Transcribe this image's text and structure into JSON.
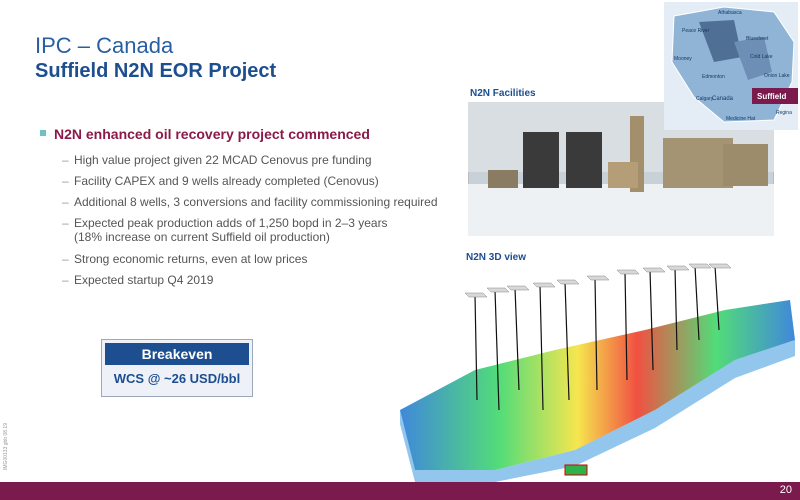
{
  "slide": {
    "title_line1": "IPC – Canada",
    "title_line2": "Suffield N2N EOR Project",
    "main_bullet": "N2N enhanced oil recovery project commenced",
    "sub_items": [
      "High value project given 22 MCAD Cenovus pre funding",
      "Facility CAPEX and 9 wells already completed (Cenovus)",
      "Additional 8 wells, 3 conversions and facility commissioning required",
      "Expected peak production adds of 1,250 bopd in 2–3 years",
      "(18% increase on current Suffield oil production)",
      "Strong economic returns, even at low prices",
      "Expected startup Q4 2019"
    ],
    "breakeven_title": "Breakeven",
    "breakeven_value": "WCS @ ~26 USD/bbl",
    "facilities_label": "N2N Facilities",
    "view_label": "N2N 3D view",
    "page_number": "20",
    "side_code": "IMG00133 gbb 08.19"
  },
  "map": {
    "labels": [
      "Athabasca",
      "Peace River",
      "Bluesheet",
      "Cold Lake",
      "Mooney",
      "Onion Lake",
      "Edmonton",
      "Calgary",
      "Canada",
      "Suffield",
      "Regina",
      "Medicine Hat"
    ]
  },
  "colors": {
    "primary_blue": "#1d4e8f",
    "accent_maroon": "#7b1a4d",
    "bullet_teal": "#6fc1c4"
  }
}
